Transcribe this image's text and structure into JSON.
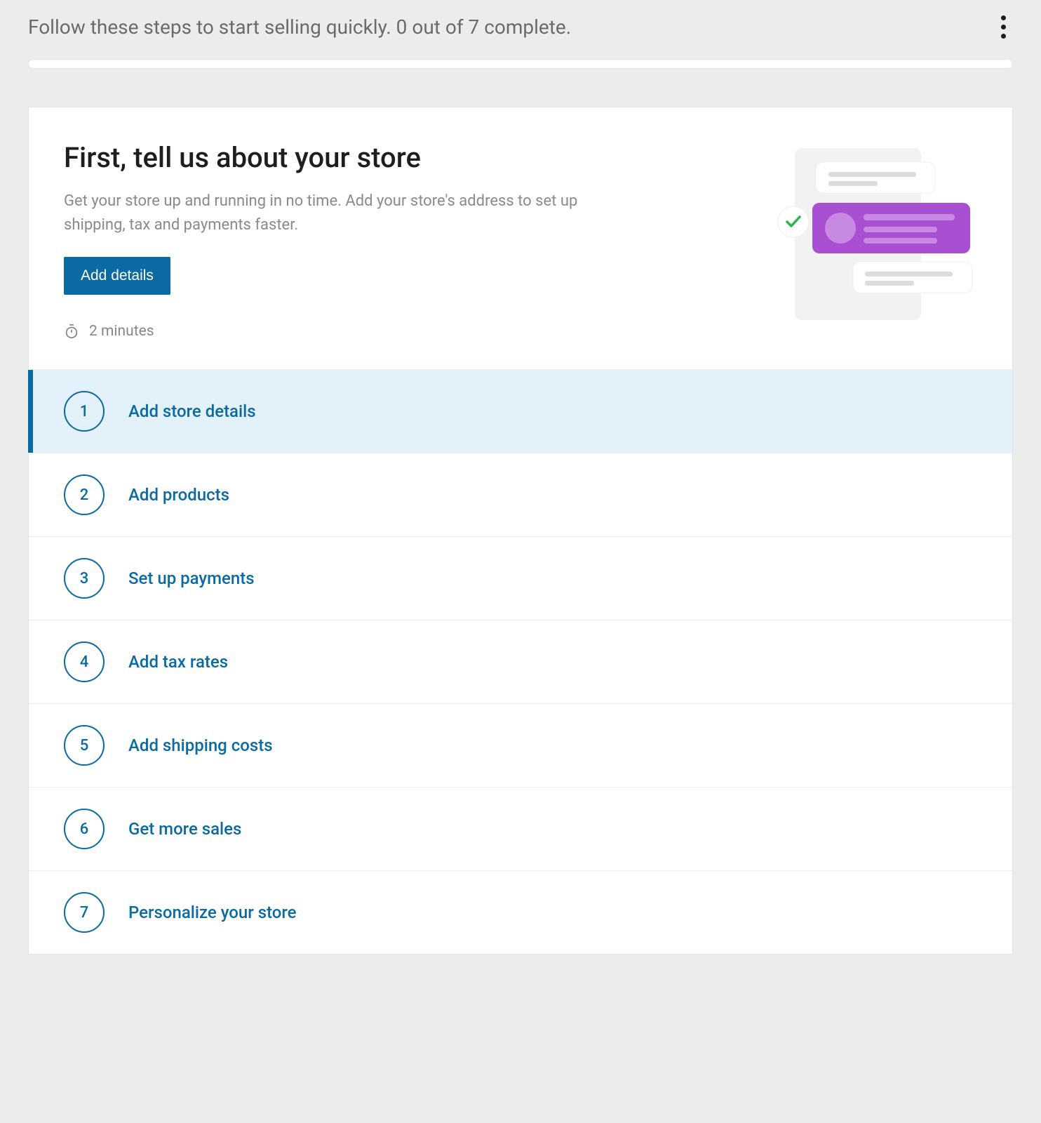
{
  "header": {
    "text": "Follow these steps to start selling quickly. 0 out of 7 complete."
  },
  "hero": {
    "title": "First, tell us about your store",
    "description": "Get your store up and running in no time. Add your store's address to set up shipping, tax and payments faster.",
    "button_label": "Add details",
    "time_estimate": "2 minutes"
  },
  "tasks": [
    {
      "num": "1",
      "label": "Add store details",
      "active": true
    },
    {
      "num": "2",
      "label": "Add products",
      "active": false
    },
    {
      "num": "3",
      "label": "Set up payments",
      "active": false
    },
    {
      "num": "4",
      "label": "Add tax rates",
      "active": false
    },
    {
      "num": "5",
      "label": "Add shipping costs",
      "active": false
    },
    {
      "num": "6",
      "label": "Get more sales",
      "active": false
    },
    {
      "num": "7",
      "label": "Personalize your store",
      "active": false
    }
  ]
}
